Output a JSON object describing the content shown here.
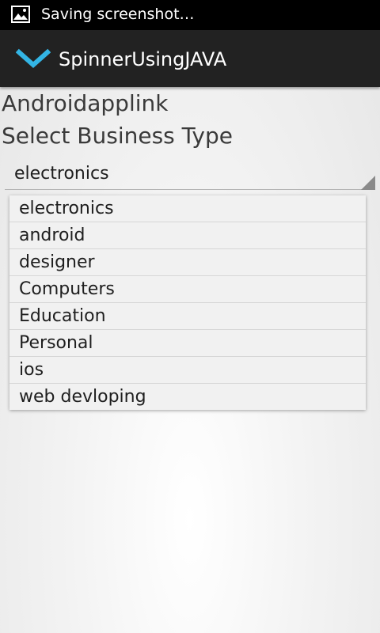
{
  "status_bar": {
    "text": "Saving screenshot…",
    "icon": "image-icon"
  },
  "action_bar": {
    "title": "SpinnerUsingJAVA",
    "icon": "chevron-down-icon",
    "icon_color": "#33b5e5"
  },
  "content": {
    "text1": "Androidapplink",
    "text2": "Select Business Type"
  },
  "spinner": {
    "selected": "electronics",
    "options": [
      "electronics",
      "android",
      "designer",
      "Computers",
      "Education",
      "Personal",
      "ios",
      "web devloping"
    ]
  }
}
